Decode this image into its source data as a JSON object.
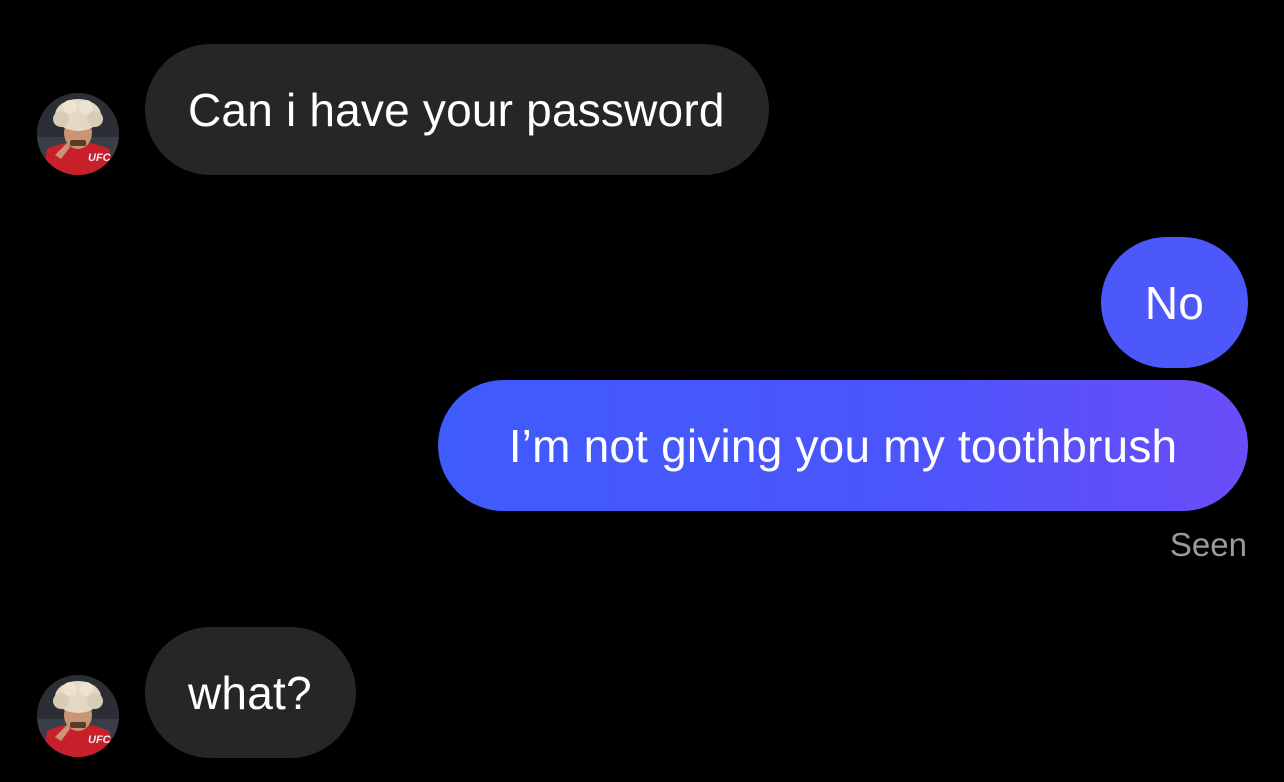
{
  "messages": [
    {
      "sender": "them",
      "text": "Can i have your password"
    },
    {
      "sender": "me",
      "text": "No"
    },
    {
      "sender": "me",
      "text": "I’m not giving you my toothbrush"
    },
    {
      "sender": "them",
      "text": "what?"
    }
  ],
  "receipt": {
    "status": "Seen"
  },
  "contact": {
    "avatar_shirt_text": "UFC"
  },
  "colors": {
    "background": "#000000",
    "incoming_bubble": "#262626",
    "outgoing_start": "#3f5bfb",
    "outgoing_end": "#6a4df8",
    "text": "#ffffff",
    "seen_text": "#9a9a9a"
  }
}
